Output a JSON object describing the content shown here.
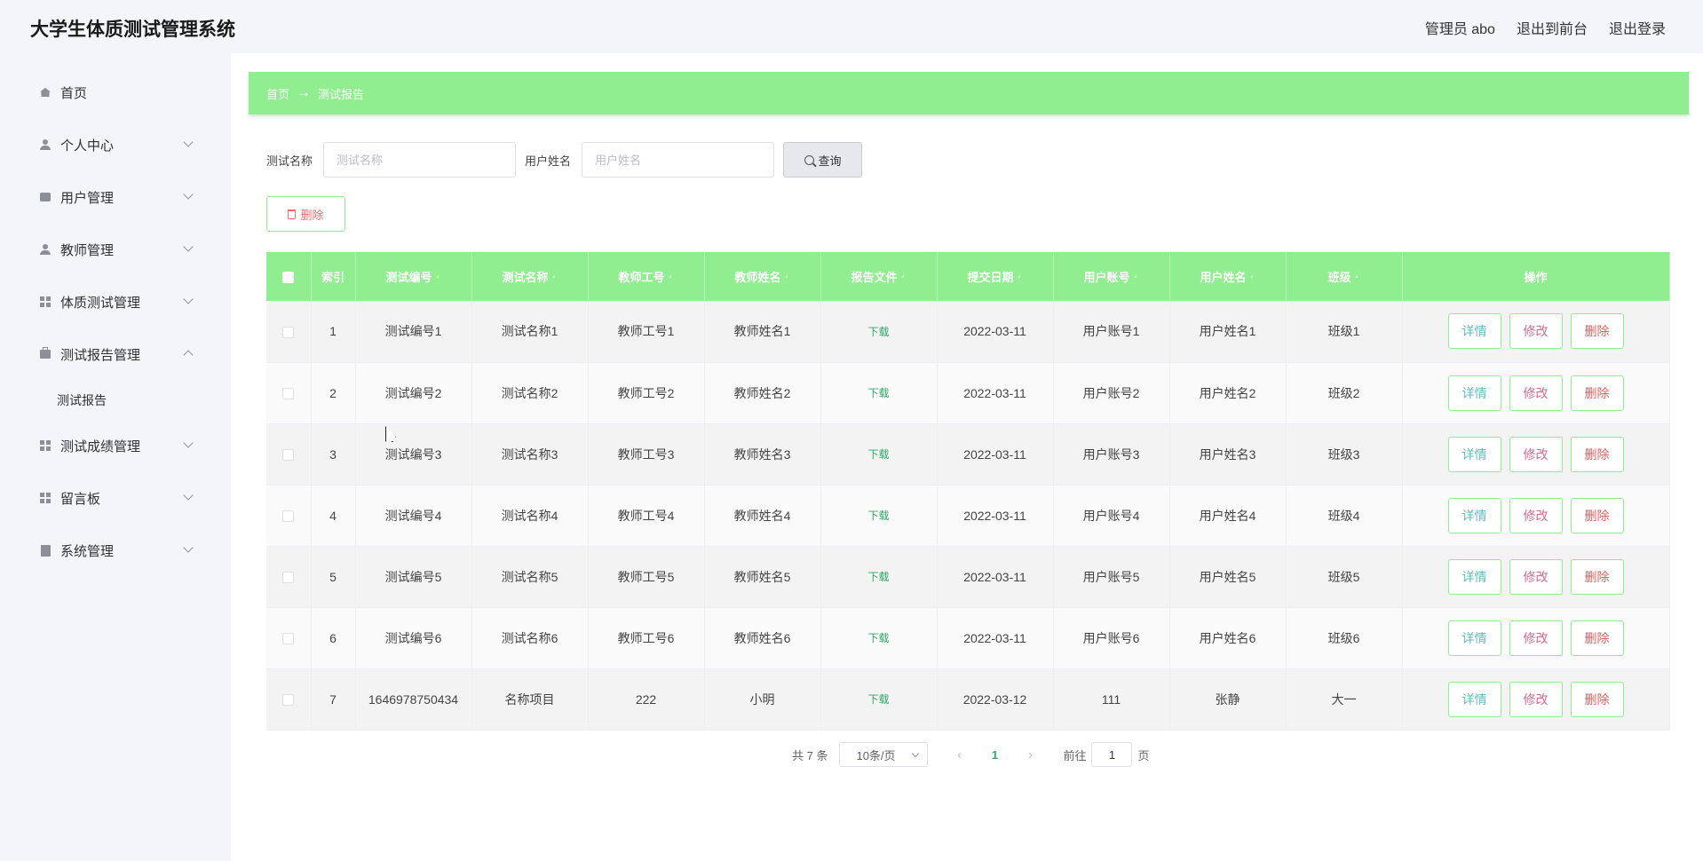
{
  "header": {
    "title": "大学生体质测试管理系统",
    "admin_label": "管理员 abo",
    "front_label": "退出到前台",
    "logout_label": "退出登录"
  },
  "sidebar": {
    "items": [
      {
        "label": "首页",
        "icon": "home-icon"
      },
      {
        "label": "个人中心",
        "icon": "user-icon"
      },
      {
        "label": "用户管理",
        "icon": "card-icon"
      },
      {
        "label": "教师管理",
        "icon": "user-icon"
      },
      {
        "label": "体质测试管理",
        "icon": "grid-icon"
      },
      {
        "label": "测试报告管理",
        "icon": "briefcase-icon"
      },
      {
        "label": "测试成绩管理",
        "icon": "grid-icon"
      },
      {
        "label": "留言板",
        "icon": "grid-icon"
      },
      {
        "label": "系统管理",
        "icon": "clipboard-icon"
      }
    ],
    "sub_item": "测试报告"
  },
  "breadcrumb": {
    "home": "首页",
    "arrow": "→",
    "current": "测试报告"
  },
  "search": {
    "name_label": "测试名称",
    "name_placeholder": "测试名称",
    "user_label": "用户姓名",
    "user_placeholder": "用户姓名",
    "query_label": "查询"
  },
  "toolbar": {
    "delete_label": "删除"
  },
  "table": {
    "columns": [
      "索引",
      "测试编号",
      "测试名称",
      "教师工号",
      "教师姓名",
      "报告文件",
      "提交日期",
      "用户账号",
      "用户姓名",
      "班级",
      "操作"
    ],
    "download_label": "下载",
    "actions": {
      "detail": "详情",
      "edit": "修改",
      "delete": "删除"
    },
    "rows": [
      {
        "index": "1",
        "test_no": "测试编号1",
        "test_name": "测试名称1",
        "teacher_no": "教师工号1",
        "teacher_name": "教师姓名1",
        "date": "2022-03-11",
        "account": "用户账号1",
        "user_name": "用户姓名1",
        "class": "班级1"
      },
      {
        "index": "2",
        "test_no": "测试编号2",
        "test_name": "测试名称2",
        "teacher_no": "教师工号2",
        "teacher_name": "教师姓名2",
        "date": "2022-03-11",
        "account": "用户账号2",
        "user_name": "用户姓名2",
        "class": "班级2"
      },
      {
        "index": "3",
        "test_no": "测试编号3",
        "test_name": "测试名称3",
        "teacher_no": "教师工号3",
        "teacher_name": "教师姓名3",
        "date": "2022-03-11",
        "account": "用户账号3",
        "user_name": "用户姓名3",
        "class": "班级3"
      },
      {
        "index": "4",
        "test_no": "测试编号4",
        "test_name": "测试名称4",
        "teacher_no": "教师工号4",
        "teacher_name": "教师姓名4",
        "date": "2022-03-11",
        "account": "用户账号4",
        "user_name": "用户姓名4",
        "class": "班级4"
      },
      {
        "index": "5",
        "test_no": "测试编号5",
        "test_name": "测试名称5",
        "teacher_no": "教师工号5",
        "teacher_name": "教师姓名5",
        "date": "2022-03-11",
        "account": "用户账号5",
        "user_name": "用户姓名5",
        "class": "班级5"
      },
      {
        "index": "6",
        "test_no": "测试编号6",
        "test_name": "测试名称6",
        "teacher_no": "教师工号6",
        "teacher_name": "教师姓名6",
        "date": "2022-03-11",
        "account": "用户账号6",
        "user_name": "用户姓名6",
        "class": "班级6"
      },
      {
        "index": "7",
        "test_no": "1646978750434",
        "test_name": "名称项目",
        "teacher_no": "222",
        "teacher_name": "小明",
        "date": "2022-03-12",
        "account": "111",
        "user_name": "张静",
        "class": "大一"
      }
    ]
  },
  "pagination": {
    "total_label": "共 7 条",
    "page_size": "10条/页",
    "current_page": "1",
    "goto_prefix": "前往",
    "goto_value": "1",
    "goto_suffix": "页"
  },
  "colors": {
    "accent_green": "#90ee90",
    "link_green": "#2ea76a",
    "danger": "#f56c6c"
  }
}
